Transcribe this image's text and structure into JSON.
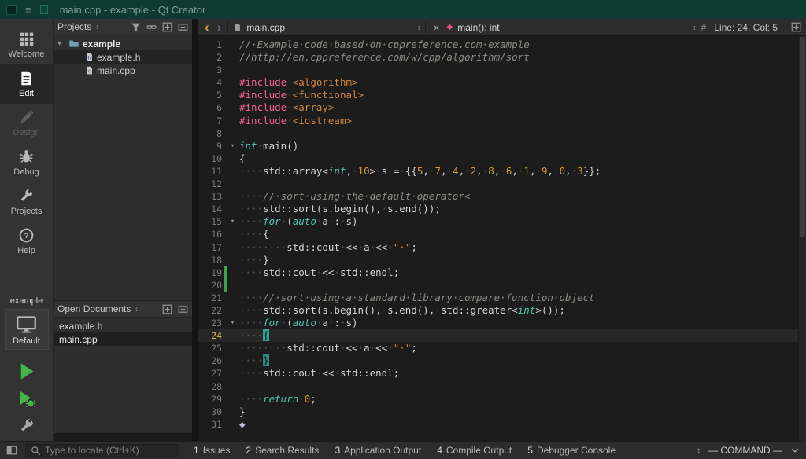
{
  "window": {
    "title": "main.cpp - example - Qt Creator"
  },
  "modebar": {
    "modes": [
      {
        "label": "Welcome",
        "icon": "welcome-grid",
        "state": "normal"
      },
      {
        "label": "Edit",
        "icon": "edit-document",
        "state": "selected"
      },
      {
        "label": "Design",
        "icon": "design-pencil",
        "state": "disabled"
      },
      {
        "label": "Debug",
        "icon": "debug-bug",
        "state": "normal"
      },
      {
        "label": "Projects",
        "icon": "projects-wrench",
        "state": "normal"
      },
      {
        "label": "Help",
        "icon": "help-circle",
        "state": "normal"
      }
    ],
    "kit": {
      "project": "example",
      "target": "Default"
    }
  },
  "projects_panel": {
    "title": "Projects",
    "tree": [
      {
        "label": "example",
        "type": "project",
        "level": 0,
        "expanded": true,
        "selected": false
      },
      {
        "label": "example.h",
        "type": "header",
        "level": 1,
        "selected": true
      },
      {
        "label": "main.cpp",
        "type": "source",
        "level": 1,
        "selected": false
      }
    ]
  },
  "open_documents": {
    "title": "Open Documents",
    "items": [
      {
        "label": "example.h",
        "active": false
      },
      {
        "label": "main.cpp",
        "active": true
      }
    ]
  },
  "editor_bar": {
    "file_name": "main.cpp",
    "symbol": "main(): int",
    "hash": "#",
    "line_col": "Line: 24, Col: 5"
  },
  "statusbar": {
    "locator_placeholder": "Type to locate (Ctrl+K)",
    "panels": [
      {
        "num": "1",
        "label": "Issues"
      },
      {
        "num": "2",
        "label": "Search Results"
      },
      {
        "num": "3",
        "label": "Application Output"
      },
      {
        "num": "4",
        "label": "Compile Output"
      },
      {
        "num": "5",
        "label": "Debugger Console"
      }
    ],
    "vim_status": "— COMMAND —"
  },
  "editor": {
    "current_line": 24,
    "fold_lines": [
      9,
      15,
      23
    ],
    "changed_lines": [
      19,
      20
    ],
    "lines": [
      [
        [
          "c",
          "//·Example·code·based·on·cppreference.com·example"
        ]
      ],
      [
        [
          "c",
          "//http://en.cppreference.com/w/cpp/algorithm/sort"
        ]
      ],
      [],
      [
        [
          "p",
          "#include"
        ],
        [
          "w",
          "·"
        ],
        [
          "i",
          "<algorithm>"
        ]
      ],
      [
        [
          "p",
          "#include"
        ],
        [
          "w",
          "·"
        ],
        [
          "i",
          "<functional>"
        ]
      ],
      [
        [
          "p",
          "#include"
        ],
        [
          "w",
          "·"
        ],
        [
          "i",
          "<array>"
        ]
      ],
      [
        [
          "p",
          "#include"
        ],
        [
          "w",
          "·"
        ],
        [
          "i",
          "<iostream>"
        ]
      ],
      [],
      [
        [
          "k",
          "int"
        ],
        [
          "w",
          "·"
        ],
        [
          "t",
          "main()"
        ]
      ],
      [
        [
          "t",
          "{"
        ]
      ],
      [
        [
          "w",
          "····"
        ],
        [
          "t",
          "std::array<"
        ],
        [
          "k",
          "int"
        ],
        [
          "t",
          ","
        ],
        [
          "w",
          "·"
        ],
        [
          "n",
          "10"
        ],
        [
          "t",
          ">"
        ],
        [
          "w",
          "·"
        ],
        [
          "t",
          "s"
        ],
        [
          "w",
          "·"
        ],
        [
          "t",
          "="
        ],
        [
          "w",
          "·"
        ],
        [
          "t",
          "{{"
        ],
        [
          "n",
          "5"
        ],
        [
          "t",
          ","
        ],
        [
          "w",
          "·"
        ],
        [
          "n",
          "7"
        ],
        [
          "t",
          ","
        ],
        [
          "w",
          "·"
        ],
        [
          "n",
          "4"
        ],
        [
          "t",
          ","
        ],
        [
          "w",
          "·"
        ],
        [
          "n",
          "2"
        ],
        [
          "t",
          ","
        ],
        [
          "w",
          "·"
        ],
        [
          "n",
          "8"
        ],
        [
          "t",
          ","
        ],
        [
          "w",
          "·"
        ],
        [
          "n",
          "6"
        ],
        [
          "t",
          ","
        ],
        [
          "w",
          "·"
        ],
        [
          "n",
          "1"
        ],
        [
          "t",
          ","
        ],
        [
          "w",
          "·"
        ],
        [
          "n",
          "9"
        ],
        [
          "t",
          ","
        ],
        [
          "w",
          "·"
        ],
        [
          "n",
          "0"
        ],
        [
          "t",
          ","
        ],
        [
          "w",
          "·"
        ],
        [
          "n",
          "3"
        ],
        [
          "t",
          "}};"
        ]
      ],
      [],
      [
        [
          "w",
          "····"
        ],
        [
          "c",
          "//·sort·using·the·default·operator<"
        ]
      ],
      [
        [
          "w",
          "····"
        ],
        [
          "t",
          "std::sort(s.begin(),"
        ],
        [
          "w",
          "·"
        ],
        [
          "t",
          "s.end());"
        ]
      ],
      [
        [
          "w",
          "····"
        ],
        [
          "k",
          "for"
        ],
        [
          "w",
          "·"
        ],
        [
          "t",
          "("
        ],
        [
          "k",
          "auto"
        ],
        [
          "w",
          "·"
        ],
        [
          "t",
          "a"
        ],
        [
          "w",
          "·"
        ],
        [
          "t",
          ":"
        ],
        [
          "w",
          "·"
        ],
        [
          "t",
          "s)"
        ]
      ],
      [
        [
          "w",
          "····"
        ],
        [
          "t",
          "{"
        ]
      ],
      [
        [
          "w",
          "········"
        ],
        [
          "t",
          "std::cout"
        ],
        [
          "w",
          "·"
        ],
        [
          "t",
          "<<"
        ],
        [
          "w",
          "·"
        ],
        [
          "t",
          "a"
        ],
        [
          "w",
          "·"
        ],
        [
          "t",
          "<<"
        ],
        [
          "w",
          "·"
        ],
        [
          "s",
          "\"·\""
        ],
        [
          "t",
          ";"
        ]
      ],
      [
        [
          "w",
          "····"
        ],
        [
          "t",
          "}"
        ]
      ],
      [
        [
          "w",
          "····"
        ],
        [
          "t",
          "std::cout"
        ],
        [
          "w",
          "·"
        ],
        [
          "t",
          "<<"
        ],
        [
          "w",
          "·"
        ],
        [
          "t",
          "std::endl;"
        ]
      ],
      [],
      [
        [
          "w",
          "····"
        ],
        [
          "c",
          "//·sort·using·a·standard·library·compare·function·object"
        ]
      ],
      [
        [
          "w",
          "····"
        ],
        [
          "t",
          "std::sort(s.begin(),"
        ],
        [
          "w",
          "·"
        ],
        [
          "t",
          "s.end(),"
        ],
        [
          "w",
          "·"
        ],
        [
          "t",
          "std::greater<"
        ],
        [
          "k",
          "int"
        ],
        [
          "t",
          ">());"
        ]
      ],
      [
        [
          "w",
          "····"
        ],
        [
          "k",
          "for"
        ],
        [
          "w",
          "·"
        ],
        [
          "t",
          "("
        ],
        [
          "k",
          "auto"
        ],
        [
          "w",
          "·"
        ],
        [
          "t",
          "a"
        ],
        [
          "w",
          "·"
        ],
        [
          "t",
          ":"
        ],
        [
          "w",
          "·"
        ],
        [
          "t",
          "s)"
        ]
      ],
      [
        [
          "w",
          "····"
        ],
        [
          "cur",
          "{"
        ]
      ],
      [
        [
          "w",
          "········"
        ],
        [
          "t",
          "std::cout"
        ],
        [
          "w",
          "·"
        ],
        [
          "t",
          "<<"
        ],
        [
          "w",
          "·"
        ],
        [
          "t",
          "a"
        ],
        [
          "w",
          "·"
        ],
        [
          "t",
          "<<"
        ],
        [
          "w",
          "·"
        ],
        [
          "s",
          "\"·\""
        ],
        [
          "t",
          ";"
        ]
      ],
      [
        [
          "w",
          "····"
        ],
        [
          "m",
          "}"
        ]
      ],
      [
        [
          "w",
          "····"
        ],
        [
          "t",
          "std::cout"
        ],
        [
          "w",
          "·"
        ],
        [
          "t",
          "<<"
        ],
        [
          "w",
          "·"
        ],
        [
          "t",
          "std::endl;"
        ]
      ],
      [],
      [
        [
          "w",
          "····"
        ],
        [
          "k",
          "return"
        ],
        [
          "w",
          "·"
        ],
        [
          "n",
          "0"
        ],
        [
          "t",
          ";"
        ]
      ],
      [
        [
          "t",
          "}"
        ]
      ],
      [
        [
          "d",
          "◆"
        ]
      ]
    ]
  },
  "colors": {
    "titlebar_bg": "#0d3a33",
    "editor_bg": "#1c1c1c",
    "keyword": "#4ec5ae",
    "preprocessor": "#f2628f",
    "include_path": "#cf8440",
    "number": "#d29a44",
    "string": "#cf8440",
    "comment": "#8c8c85",
    "plain": "#d2d2d2",
    "whitespace_dot": "#575757",
    "cursor_teal": "#2ea393",
    "current_line_number": "#d9bd4e",
    "symbol_diamond": "#e0507e",
    "back_chevron": "#d2a24a",
    "change_bar_green": "#3fa34d",
    "accent_green": "#45b54a"
  }
}
